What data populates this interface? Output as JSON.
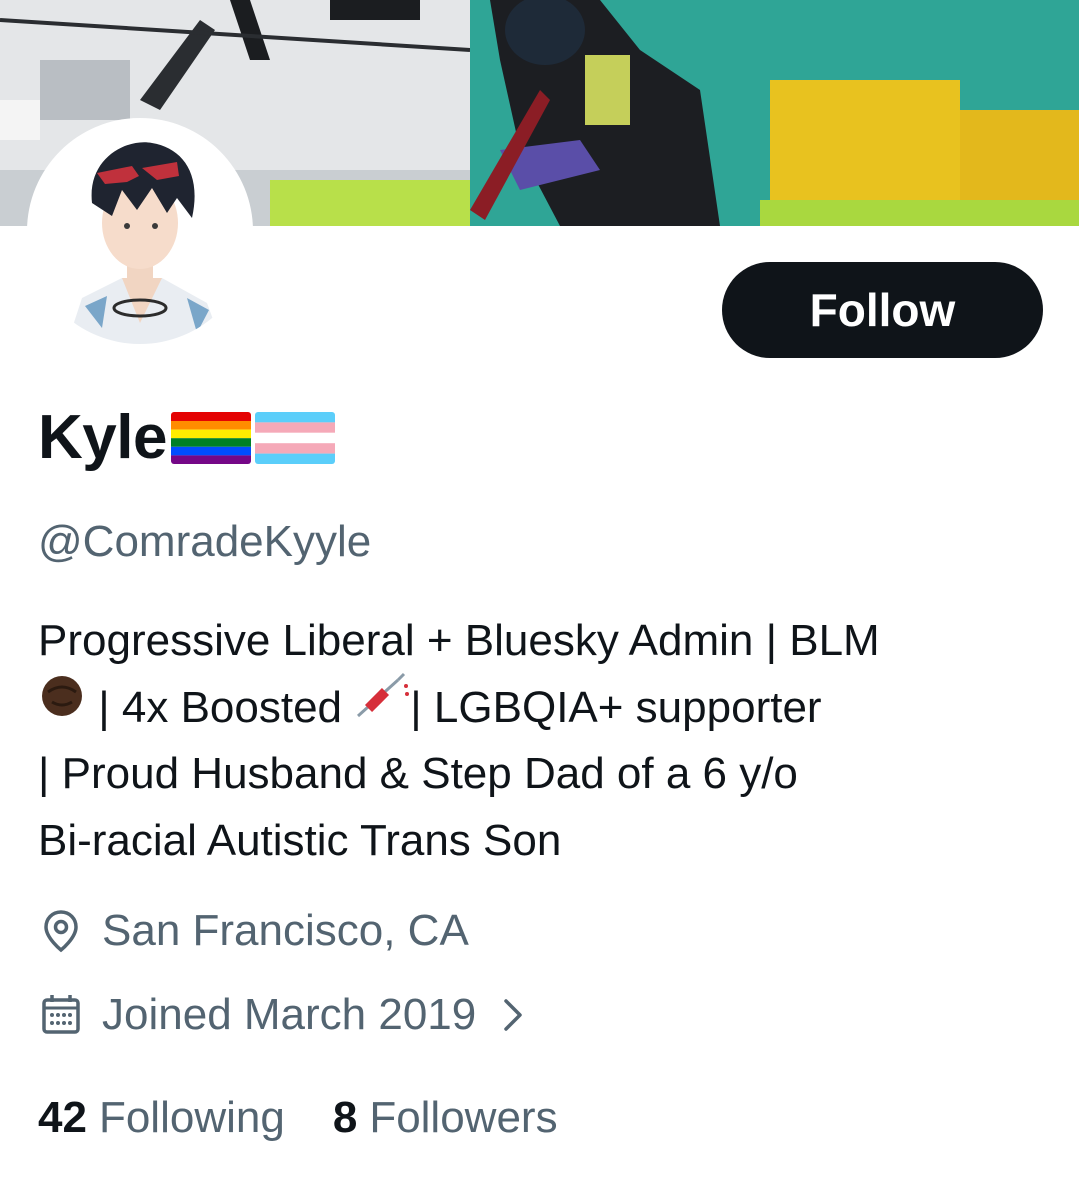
{
  "profile": {
    "display_name": "Kyle",
    "name_emojis": [
      "rainbow-flag",
      "transgender-flag"
    ],
    "handle": "@ComradeKyyle",
    "follow_label": "Follow",
    "bio": {
      "line1": "Progressive Liberal + Bluesky Admin | BLM",
      "line2_a": " | 4x Boosted ",
      "line2_b": "| LGBQIA+ supporter",
      "line3": "| Proud Husband & Step Dad of a 6 y/o",
      "line4": "Bi-racial Autistic Trans Son",
      "emojis": [
        "raised-fist-dark",
        "syringe"
      ]
    },
    "location": "San Francisco, CA",
    "joined": "Joined March 2019",
    "following_count": "42",
    "following_label": "Following",
    "followers_count": "8",
    "followers_label": "Followers"
  },
  "colors": {
    "text": "#0f1419",
    "secondary_text": "#536471",
    "button_bg": "#0f1419",
    "button_text": "#ffffff"
  }
}
